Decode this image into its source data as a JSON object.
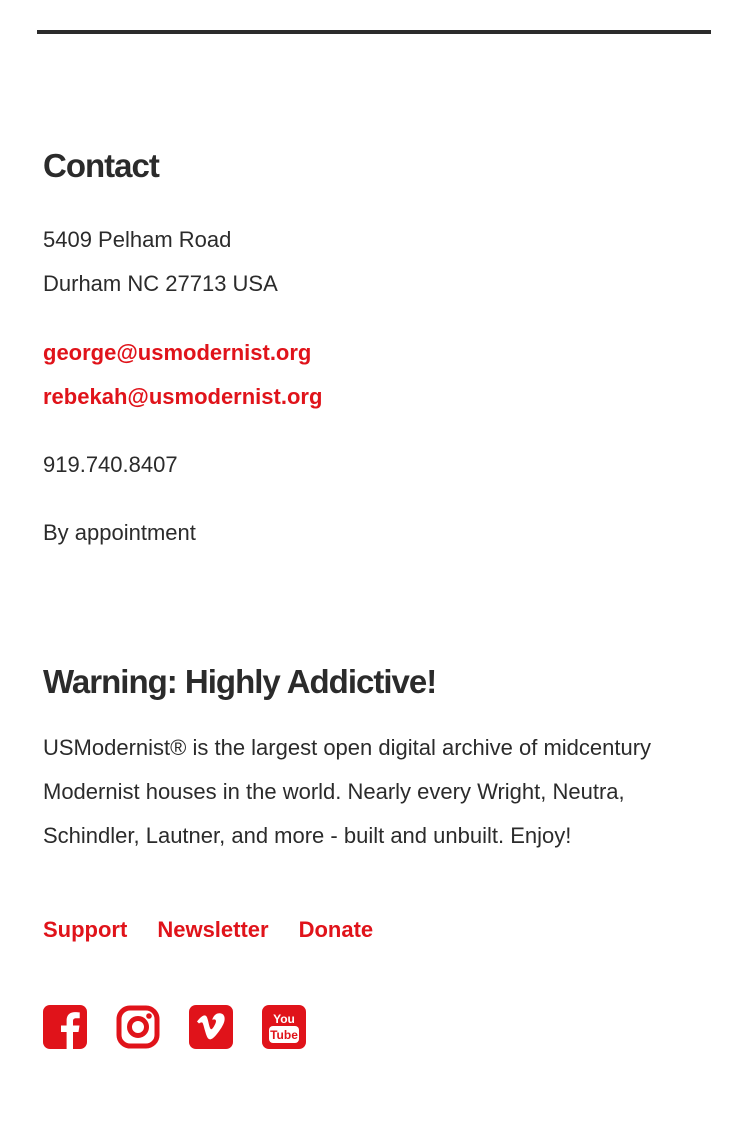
{
  "contact": {
    "heading": "Contact",
    "address_line1": "5409 Pelham Road",
    "address_line2": "Durham NC 27713 USA",
    "emails": [
      "george@usmodernist.org",
      "rebekah@usmodernist.org"
    ],
    "phone": "919.740.8407",
    "hours": "By appointment"
  },
  "warning": {
    "heading": "Warning: Highly Addictive!",
    "body": "USModernist® is the largest open digital archive of midcentury Modernist houses in the world. Nearly every Wright, Neutra, Schindler, Lautner, and more - built and unbuilt. Enjoy!"
  },
  "links": {
    "support": "Support",
    "newsletter": "Newsletter",
    "donate": "Donate"
  },
  "social": {
    "icons": [
      "facebook-icon",
      "instagram-icon",
      "vimeo-icon",
      "youtube-icon"
    ],
    "youtube_word1": "You",
    "youtube_word2": "Tube"
  },
  "colors": {
    "accent": "#e0131a",
    "text": "#2b2b2b",
    "background": "#ffffff"
  }
}
